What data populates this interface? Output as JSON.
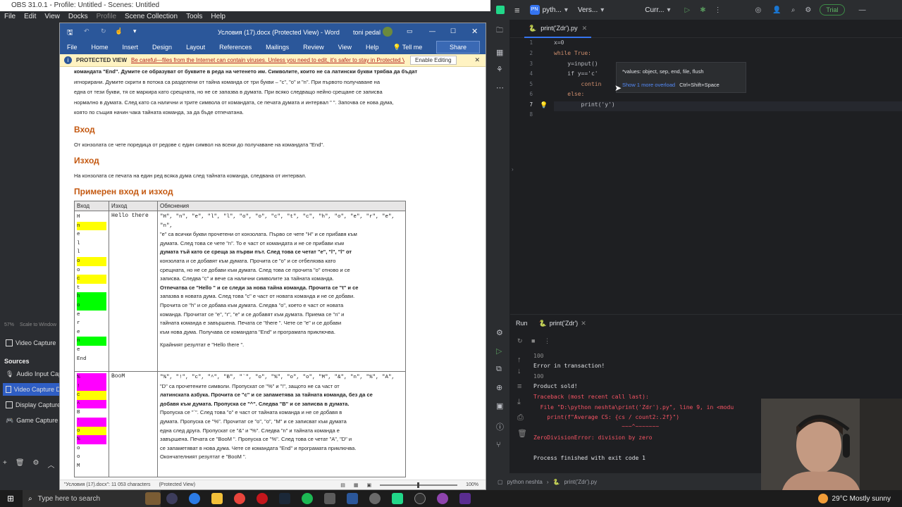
{
  "obs": {
    "title": "OBS 31.0.1 - Profile: Untitled - Scenes: Untitled",
    "menu": [
      "File",
      "Edit",
      "View",
      "Docks",
      "Profile",
      "Scene Collection",
      "Tools",
      "Help"
    ],
    "scale_text": "57%",
    "scale_label": "Scale to Window",
    "sources_header": "Sources",
    "top_source": "Video Capture",
    "sources": [
      "Audio Input Capt",
      "Video Capture D",
      "Display Capture",
      "Game Capture"
    ]
  },
  "word": {
    "doc_title": "Условия (17).docx (Protected View) - Word",
    "user": "toni pedal",
    "ribbon_tabs": [
      "File",
      "Home",
      "Insert",
      "Design",
      "Layout",
      "References",
      "Mailings",
      "Review",
      "View",
      "Help",
      "Tell me"
    ],
    "share": "Share",
    "protected_view_label": "PROTECTED VIEW",
    "protected_view_msg": "Be careful—files from the Internet can contain viruses. Unless you need to edit, it's safer to stay in Protected View.",
    "enable_editing": "Enable Editing",
    "intro_lines": [
      "командата \"End\". Думите се образуват от буквите в реда на четенето им. Символите, които не са латински букви трябва да бъдат",
      "игнорирани. Думите скрити в потока са разделени от тайна команда от три букви – \"c\", \"o\" и \"n\". При първото получаване на",
      "една от тези букви, тя се маркира като срещната, но не се запазва в думата. При всяко следващо нейно срещане се записва",
      "нормално в думата. След като са налични и трите символа от командата, се печата думата и интервал \" \". Започва се нова дума,",
      "която по същия начин чака тайната команда, за да бъде отпечатана."
    ],
    "h_input": "Вход",
    "input_text": "От конзолата се чете поредица от редове с един символ на всеки до получаване на командата \"End\".",
    "h_output": "Изход",
    "output_text": "На конзолата се печата на един ред всяка дума след тайната команда, следвана от интервал.",
    "h_example": "Примерен вход и изход",
    "table_headers": [
      "Вход",
      "Изход",
      "Обяснения"
    ],
    "row1_input": [
      "H",
      "n",
      "e",
      "l",
      "l",
      "o",
      "o",
      "c",
      "t",
      "h",
      "o",
      "e",
      "r",
      "e",
      "n",
      "e",
      "End"
    ],
    "row1_output": "Hello there",
    "row1_expl": [
      "\"H\", \"n\", \"e\", \"l\", \"l\", \"o\", \"o\", \"c\", \"t\", \"c\", \"h\", \"o\", \"e\", \"r\", \"e\", \"n\",",
      "\"e\" са всички букви прочетени от конзолата. Първо се чете \"H\" и се прибавя към",
      "думата. След това се чете \"n\". То е част от командата и не се прибави към",
      "думата тъй като се среща за първи път. След това се четат \"e\", \"l\", \"l\" от",
      "конзолата и се добавят към думата. Прочита се \"o\" и се отбелязва като",
      "срещната, но не се добави към думата. След това се прочита \"o\" отново и се",
      "записва. Следва \"c\" и вече са налични символите за тайната команда.",
      "Отпечатва се \"Hello \" и се следи за нова тайна команда. Прочита се \"t\" и се",
      "запазва в новата дума. След това \"c\" е част от новата команда и не се добави.",
      "Прочита се \"h\" и се добава към думата. Следва \"o\", което е част от новата",
      "команда. Прочитат се \"e\", \"r\", \"e\" и се добавят към думата. Приема се \"n\" и",
      "тайната команда е завършена. Печата се \"there \". Чете се \"e\" и се добави",
      "към нова дума. Получава се командата \"End\" и програмата приключва."
    ],
    "row1_result": "Крайният резултат е \"Hello there \".",
    "row2_input": [
      "%",
      "!",
      "c",
      "^",
      "B",
      "`",
      "o",
      "%",
      "o",
      "o",
      "M",
      "&",
      "n",
      "%",
      "A",
      "D"
    ],
    "row2_output": "BooM",
    "row2_expl": [
      "\"%\", \"!\", \"c\", \"^\", \"B\", \"`\", \"o\", \"%\", \"o\", \"o\", \"M\", \"&\", \"n\", \"%\", \"A\",",
      "\"D\" са прочетените символи. Пропускат се \"%\" и \"!\", защото не са част от",
      "латинската азбука. Прочита се \"c\" и се запаметява за тайната команда, без да се",
      "добавя към думата. Пропуска се \"^\". Следва \"B\" и се записва в думата.",
      "Пропуска се \"`\". След това \"o\" е част от тайната команда и не се добавя в",
      "думата. Пропуска се \"%\". Прочитат се \"o\", \"o\", \"M\" и се записват към думата",
      "една след друга. Пропускат се \"&\" и \"%\". Следва \"n\" и тайната команда е",
      "завършена. Печата се \"BooM \". Пропуска се \"%\". След това се четат \"A\", \"D\" и",
      "се запаметяват в нова дума. Чете се командата \"End\" и програмата приключва.",
      "Окончателният резултат е \"BooM \"."
    ],
    "status_left": "\"Условия (17).docx\": 11 053 characters",
    "status_mode": "(Protected View)",
    "zoom": "100%"
  },
  "ide": {
    "project": "pyth...",
    "vcs": "Vers...",
    "run_config": "Curr...",
    "trial": "Trial",
    "file_tab": "print('Zdr').py",
    "code": [
      {
        "ln": "1",
        "text": "x=0"
      },
      {
        "ln": "2",
        "text": "while True:"
      },
      {
        "ln": "3",
        "text": "    y=input()"
      },
      {
        "ln": "4",
        "text": "    if y=='c'"
      },
      {
        "ln": "5",
        "text": "        contin"
      },
      {
        "ln": "6",
        "text": "    else:"
      },
      {
        "ln": "7",
        "text": "        print('y')"
      },
      {
        "ln": "8",
        "text": ""
      }
    ],
    "popup_sig": "*values: object, sep, end, file, flush",
    "popup_link": "Show 1 more overload",
    "popup_shortcut": "Ctrl+Shift+Space",
    "run_tab": "Run",
    "run_file_tab": "print('Zdr')",
    "output": [
      {
        "text": "100",
        "color": "#8c8c8c"
      },
      {
        "text": "Error in transaction!",
        "color": "#dfe1e5"
      },
      {
        "text": "100",
        "color": "#8c8c8c"
      },
      {
        "text": "Product sold!",
        "color": "#dfe1e5"
      },
      {
        "text": "Traceback (most recent call last):",
        "color": "#f75464"
      },
      {
        "text": "  File \"D:\\python neshta\\print('Zdr').py\", line 9, in <modu",
        "color": "#f75464"
      },
      {
        "text": "    print(f\"Average CS: {cs / count2:.2f}\")",
        "color": "#f75464"
      },
      {
        "text": "                          ~~~^~~~~~~~",
        "color": "#f75464"
      },
      {
        "text": "ZeroDivisionError: division by zero",
        "color": "#f75464"
      },
      {
        "text": "",
        "color": "#dfe1e5"
      },
      {
        "text": "Process finished with exit code 1",
        "color": "#dfe1e5"
      }
    ],
    "breadcrumb": [
      "python neshta",
      "print('Zdr').py"
    ]
  },
  "taskbar": {
    "search_placeholder": "Type here to search",
    "weather": "29°C  Mostly sunny"
  }
}
